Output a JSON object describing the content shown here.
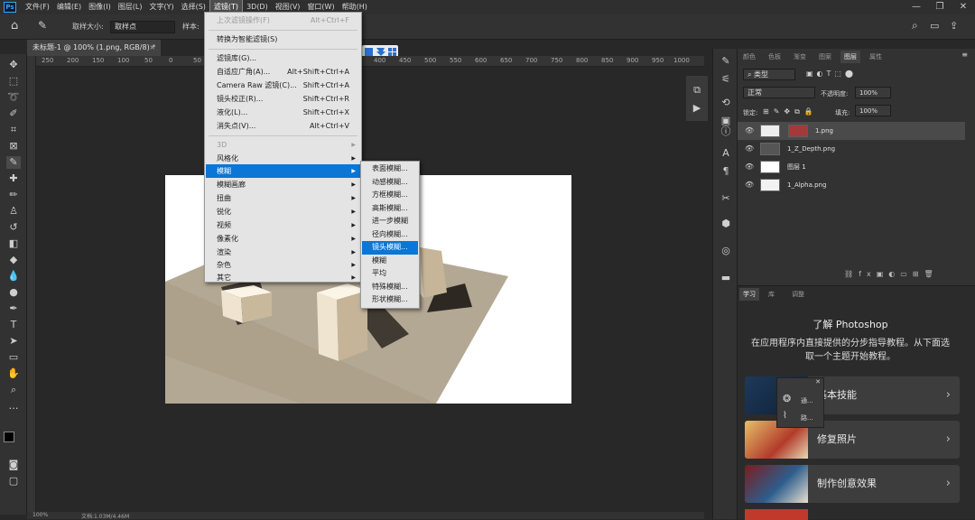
{
  "menubar": {
    "items": [
      "文件(F)",
      "编辑(E)",
      "图像(I)",
      "图层(L)",
      "文字(Y)",
      "选择(S)",
      "滤镜(T)",
      "3D(D)",
      "视图(V)",
      "窗口(W)",
      "帮助(H)"
    ],
    "active_index": 6
  },
  "options_bar": {
    "sample_size_label": "取样大小:",
    "sample_size_value": "取样点",
    "sample_label": "样本:"
  },
  "document": {
    "tab_title": "未标题-1 @ 100% (1.png, RGB/8) *",
    "ruler_ticks": [
      "250",
      "200",
      "150",
      "100",
      "50",
      "0",
      "50",
      "100",
      "150",
      "200",
      "250",
      "300",
      "350",
      "400",
      "450",
      "500",
      "550",
      "600",
      "650",
      "700",
      "750",
      "800",
      "850",
      "900",
      "950",
      "1000"
    ],
    "zoom": "100%",
    "doc_size": "文档:1.03M/4.46M"
  },
  "filter_menu": {
    "last_filter": {
      "label": "上次滤镜操作(F)",
      "shortcut": "Alt+Ctrl+F"
    },
    "convert_smart": "转换为智能滤镜(S)",
    "group1": [
      {
        "label": "滤镜库(G)...",
        "shortcut": ""
      },
      {
        "label": "自适应广角(A)...",
        "shortcut": "Alt+Shift+Ctrl+A"
      },
      {
        "label": "Camera Raw 滤镜(C)...",
        "shortcut": "Shift+Ctrl+A"
      },
      {
        "label": "镜头校正(R)...",
        "shortcut": "Shift+Ctrl+R"
      },
      {
        "label": "液化(L)...",
        "shortcut": "Shift+Ctrl+X"
      },
      {
        "label": "消失点(V)...",
        "shortcut": "Alt+Ctrl+V"
      }
    ],
    "group2": [
      "3D",
      "风格化",
      "模糊",
      "模糊画廊",
      "扭曲",
      "锐化",
      "视频",
      "像素化",
      "渲染",
      "杂色",
      "其它"
    ],
    "highlighted": "模糊"
  },
  "blur_submenu": {
    "items": [
      "表面模糊...",
      "动感模糊...",
      "方框模糊...",
      "高斯模糊...",
      "进一步模糊",
      "径向模糊...",
      "镜头模糊...",
      "模糊",
      "平均",
      "特殊模糊...",
      "形状模糊..."
    ],
    "highlighted": "镜头模糊..."
  },
  "layers_panel": {
    "tabs": [
      "颜色",
      "色板",
      "渐变",
      "图案",
      "图层",
      "属性"
    ],
    "active_tab": "图层",
    "kind_filter": "类型",
    "blend_mode": "正常",
    "opacity_label": "不透明度:",
    "opacity_value": "100%",
    "lock_label": "锁定:",
    "fill_label": "填充:",
    "fill_value": "100%",
    "layers": [
      "1.png",
      "1_Z_Depth.png",
      "图层 1",
      "1_Alpha.png"
    ],
    "selected_layer": "1.png"
  },
  "learn_panel": {
    "tabs": [
      "学习",
      "库",
      "调整"
    ],
    "heading": "了解 Photoshop",
    "description": "在应用程序内直接提供的分步指导教程。从下面选取一个主题开始教程。",
    "cards": [
      "基本技能",
      "修复照片",
      "制作创意效果"
    ]
  },
  "mini_panel": {
    "items": [
      "通...",
      "路..."
    ]
  },
  "colors": {
    "highlight": "#0b76d6",
    "panel_bg": "#323232",
    "canvas_bg": "#282828",
    "floor": "#b3a893"
  }
}
